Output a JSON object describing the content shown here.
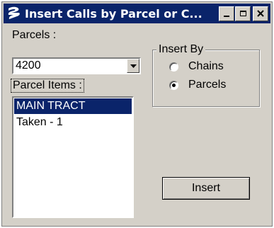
{
  "window": {
    "title": "Insert Calls by Parcel or C...",
    "title_bar_color": "#0a246a",
    "face_color": "#d4d0c8",
    "icons": [
      "app-logo-icon",
      "minimize-icon",
      "maximize-icon",
      "close-icon"
    ]
  },
  "parcels": {
    "label": "Parcels :",
    "selected_value": "4200"
  },
  "parcel_items": {
    "label": "Parcel Items :",
    "items": [
      {
        "label": "MAIN TRACT",
        "selected": true
      },
      {
        "label": "Taken - 1",
        "selected": false
      }
    ]
  },
  "insert_by": {
    "title": "Insert By",
    "options": [
      {
        "label": "Chains",
        "checked": false
      },
      {
        "label": "Parcels",
        "checked": true
      }
    ]
  },
  "actions": {
    "insert_label": "Insert"
  }
}
